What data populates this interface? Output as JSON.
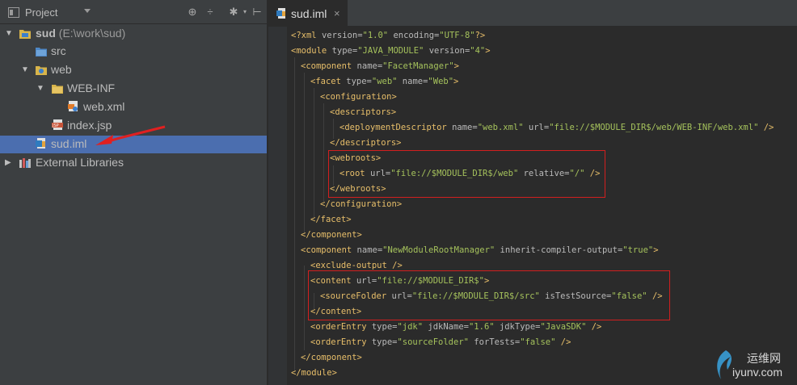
{
  "project_panel": {
    "title": "Project",
    "tree": [
      {
        "label": "sud",
        "path": "(E:\\work\\sud)",
        "type": "module-folder"
      },
      {
        "label": "src",
        "type": "source-folder"
      },
      {
        "label": "web",
        "type": "web-folder"
      },
      {
        "label": "WEB-INF",
        "type": "folder"
      },
      {
        "label": "web.xml",
        "type": "xml-file"
      },
      {
        "label": "index.jsp",
        "type": "jsp-file"
      },
      {
        "label": "sud.iml",
        "type": "iml-file",
        "selected": true
      },
      {
        "label": "External Libraries",
        "type": "libraries"
      }
    ]
  },
  "editor": {
    "tab_label": "sud.iml",
    "lines": [
      [
        [
          "tg",
          "<?xml "
        ],
        [
          "an",
          "version="
        ],
        [
          "av",
          "\"1.0\""
        ],
        [
          "an",
          " encoding="
        ],
        [
          "av",
          "\"UTF-8\""
        ],
        [
          "tg",
          "?>"
        ]
      ],
      [
        [
          "tg",
          "<module "
        ],
        [
          "an",
          "type="
        ],
        [
          "av",
          "\"JAVA_MODULE\""
        ],
        [
          "an",
          " version="
        ],
        [
          "av",
          "\"4\""
        ],
        [
          "tg",
          ">"
        ]
      ],
      [
        [
          "tg",
          "<component "
        ],
        [
          "an",
          "name="
        ],
        [
          "av",
          "\"FacetManager\""
        ],
        [
          "tg",
          ">"
        ]
      ],
      [
        [
          "tg",
          "<facet "
        ],
        [
          "an",
          "type="
        ],
        [
          "av",
          "\"web\""
        ],
        [
          "an",
          " name="
        ],
        [
          "av",
          "\"Web\""
        ],
        [
          "tg",
          ">"
        ]
      ],
      [
        [
          "tg",
          "<configuration>"
        ]
      ],
      [
        [
          "tg",
          "<descriptors>"
        ]
      ],
      [
        [
          "tg",
          "<deploymentDescriptor "
        ],
        [
          "an",
          "name="
        ],
        [
          "av",
          "\"web.xml\""
        ],
        [
          "an",
          " url="
        ],
        [
          "av",
          "\"file://$MODULE_DIR$/web/WEB-INF/web.xml\""
        ],
        [
          "tg",
          " />"
        ]
      ],
      [
        [
          "tg",
          "</descriptors>"
        ]
      ],
      [
        [
          "tg",
          "<webroots>"
        ]
      ],
      [
        [
          "tg",
          "<root "
        ],
        [
          "an",
          "url="
        ],
        [
          "av",
          "\"file://$MODULE_DIR$/web\""
        ],
        [
          "an",
          " relative="
        ],
        [
          "av",
          "\"/\""
        ],
        [
          "tg",
          " />"
        ]
      ],
      [
        [
          "tg",
          "</webroots>"
        ]
      ],
      [
        [
          "tg",
          "</configuration>"
        ]
      ],
      [
        [
          "tg",
          "</facet>"
        ]
      ],
      [
        [
          "tg",
          "</component>"
        ]
      ],
      [
        [
          "tg",
          "<component "
        ],
        [
          "an",
          "name="
        ],
        [
          "av",
          "\"NewModuleRootManager\""
        ],
        [
          "an",
          " inherit-compiler-output="
        ],
        [
          "av",
          "\"true\""
        ],
        [
          "tg",
          ">"
        ]
      ],
      [
        [
          "tg",
          "<exclude-output />"
        ]
      ],
      [
        [
          "tg",
          "<content "
        ],
        [
          "an",
          "url="
        ],
        [
          "av",
          "\"file://$MODULE_DIR$\""
        ],
        [
          "tg",
          ">"
        ]
      ],
      [
        [
          "tg",
          "<sourceFolder "
        ],
        [
          "an",
          "url="
        ],
        [
          "av",
          "\"file://$MODULE_DIR$/src\""
        ],
        [
          "an",
          " isTestSource="
        ],
        [
          "av",
          "\"false\""
        ],
        [
          "tg",
          " />"
        ]
      ],
      [
        [
          "tg",
          "</content>"
        ]
      ],
      [
        [
          "tg",
          "<orderEntry "
        ],
        [
          "an",
          "type="
        ],
        [
          "av",
          "\"jdk\""
        ],
        [
          "an",
          " jdkName="
        ],
        [
          "av",
          "\"1.6\""
        ],
        [
          "an",
          " jdkType="
        ],
        [
          "av",
          "\"JavaSDK\""
        ],
        [
          "tg",
          " />"
        ]
      ],
      [
        [
          "tg",
          "<orderEntry "
        ],
        [
          "an",
          "type="
        ],
        [
          "av",
          "\"sourceFolder\""
        ],
        [
          "an",
          " forTests="
        ],
        [
          "av",
          "\"false\""
        ],
        [
          "tg",
          " />"
        ]
      ],
      [
        [
          "tg",
          "</component>"
        ]
      ],
      [
        [
          "tg",
          "</module>"
        ]
      ]
    ]
  },
  "watermark": {
    "cn": "运维网",
    "en": "iyunv.com"
  },
  "colors": {
    "selection": "#4b6eaf",
    "annotation_red": "#d21f1f"
  }
}
